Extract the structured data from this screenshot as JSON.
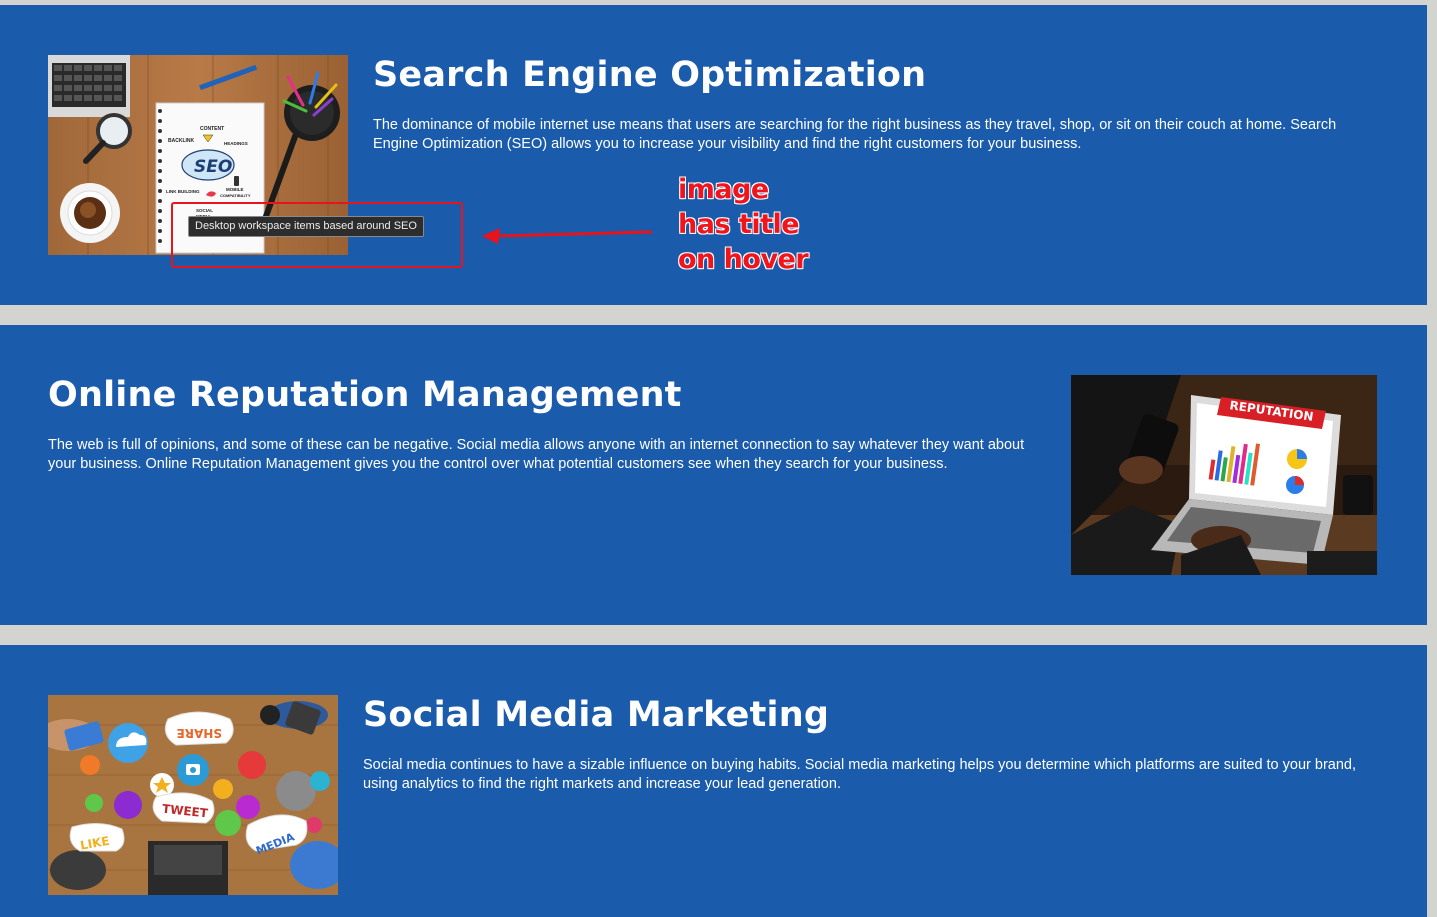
{
  "sections": [
    {
      "heading": "Search Engine Optimization",
      "body": "The dominance of mobile internet use means that users are searching for the right business as they travel, shop, or sit on their couch at home. Search Engine Optimization (SEO) allows you to increase your visibility and find the right customers for your business.",
      "image_title": "Desktop workspace items based around SEO",
      "image_text": {
        "content": "CONTENT",
        "backlink": "BACKLINK",
        "headings": "HEADINGS",
        "seo": "SEO",
        "link_building": "LINK BUILDING",
        "mobile": "MOBILE",
        "compatibility": "COMPATIBILITY",
        "social": "SOCIAL",
        "media": "MEDIA"
      }
    },
    {
      "heading": "Online Reputation Management",
      "body": "The web is full of opinions, and some of these can be negative. Social media allows anyone with an internet connection to say whatever they want about your business. Online Reputation Management gives you the control over what potential customers see when they search for your business.",
      "image_text": {
        "reputation": "REPUTATION"
      }
    },
    {
      "heading": "Social Media Marketing",
      "body": "Social media continues to have a sizable influence on buying habits. Social media marketing helps you determine which platforms are suited to your brand, using analytics to find the right markets and increase your lead generation.",
      "image_text": {
        "share": "SHARE",
        "tweet": "TWEET",
        "like": "LIKE",
        "media": "MEDIA"
      }
    }
  ],
  "annotation": {
    "lines": [
      "image",
      "has title",
      "on hover"
    ]
  },
  "colors": {
    "section_bg": "#1a5bab",
    "page_bg": "#d3d4cf",
    "annotation": "#f0141c"
  }
}
